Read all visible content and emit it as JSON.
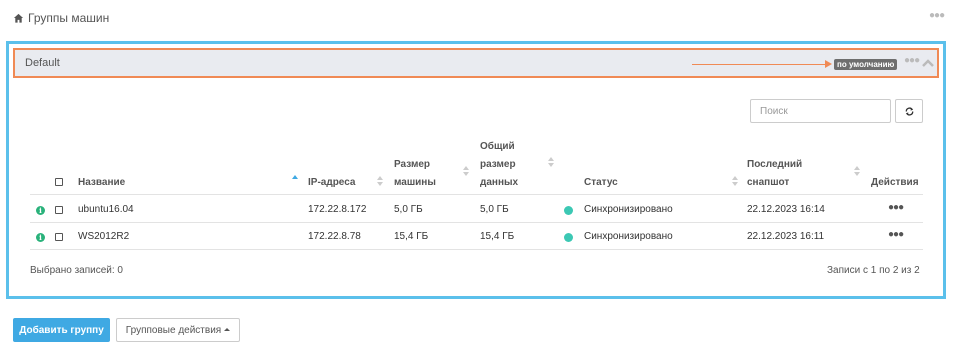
{
  "page": {
    "title": "Группы машин",
    "home_icon": "home-icon",
    "menu_icon": "ellipsis-icon"
  },
  "group": {
    "name": "Default",
    "badge": "по умолчанию",
    "collapse_icon": "chevron-up-icon",
    "menu_icon": "ellipsis-icon",
    "highlight_color": "#f08a55",
    "panel_color": "#5bc0eb"
  },
  "toolbar": {
    "search_placeholder": "Поиск",
    "refresh_icon": "refresh-icon"
  },
  "table": {
    "columns": {
      "name": "Название",
      "ip": "IP-адреса",
      "size_l1": "Размер",
      "size_l2": "машины",
      "total_l1": "Общий",
      "total_l2": "размер",
      "total_l3": "данных",
      "status": "Статус",
      "snap_l1": "Последний",
      "snap_l2": "снапшот",
      "actions": "Действия"
    },
    "rows": [
      {
        "name": "ubuntu16.04",
        "ip": "172.22.8.172",
        "size": "5,0 ГБ",
        "total": "5,0 ГБ",
        "status": "Синхронизировано",
        "snapshot": "22.12.2023 16:14",
        "status_color": "#3cc8b4"
      },
      {
        "name": "WS2012R2",
        "ip": "172.22.8.78",
        "size": "15,4 ГБ",
        "total": "15,4 ГБ",
        "status": "Синхронизировано",
        "snapshot": "22.12.2023 16:11",
        "status_color": "#3cc8b4"
      }
    ]
  },
  "footer": {
    "selected": "Выбрано записей: 0",
    "records": "Записи с 1 по 2 из 2"
  },
  "buttons": {
    "add_group": "Добавить группу",
    "group_actions": "Групповые действия",
    "primary_color": "#3fa9e3"
  }
}
